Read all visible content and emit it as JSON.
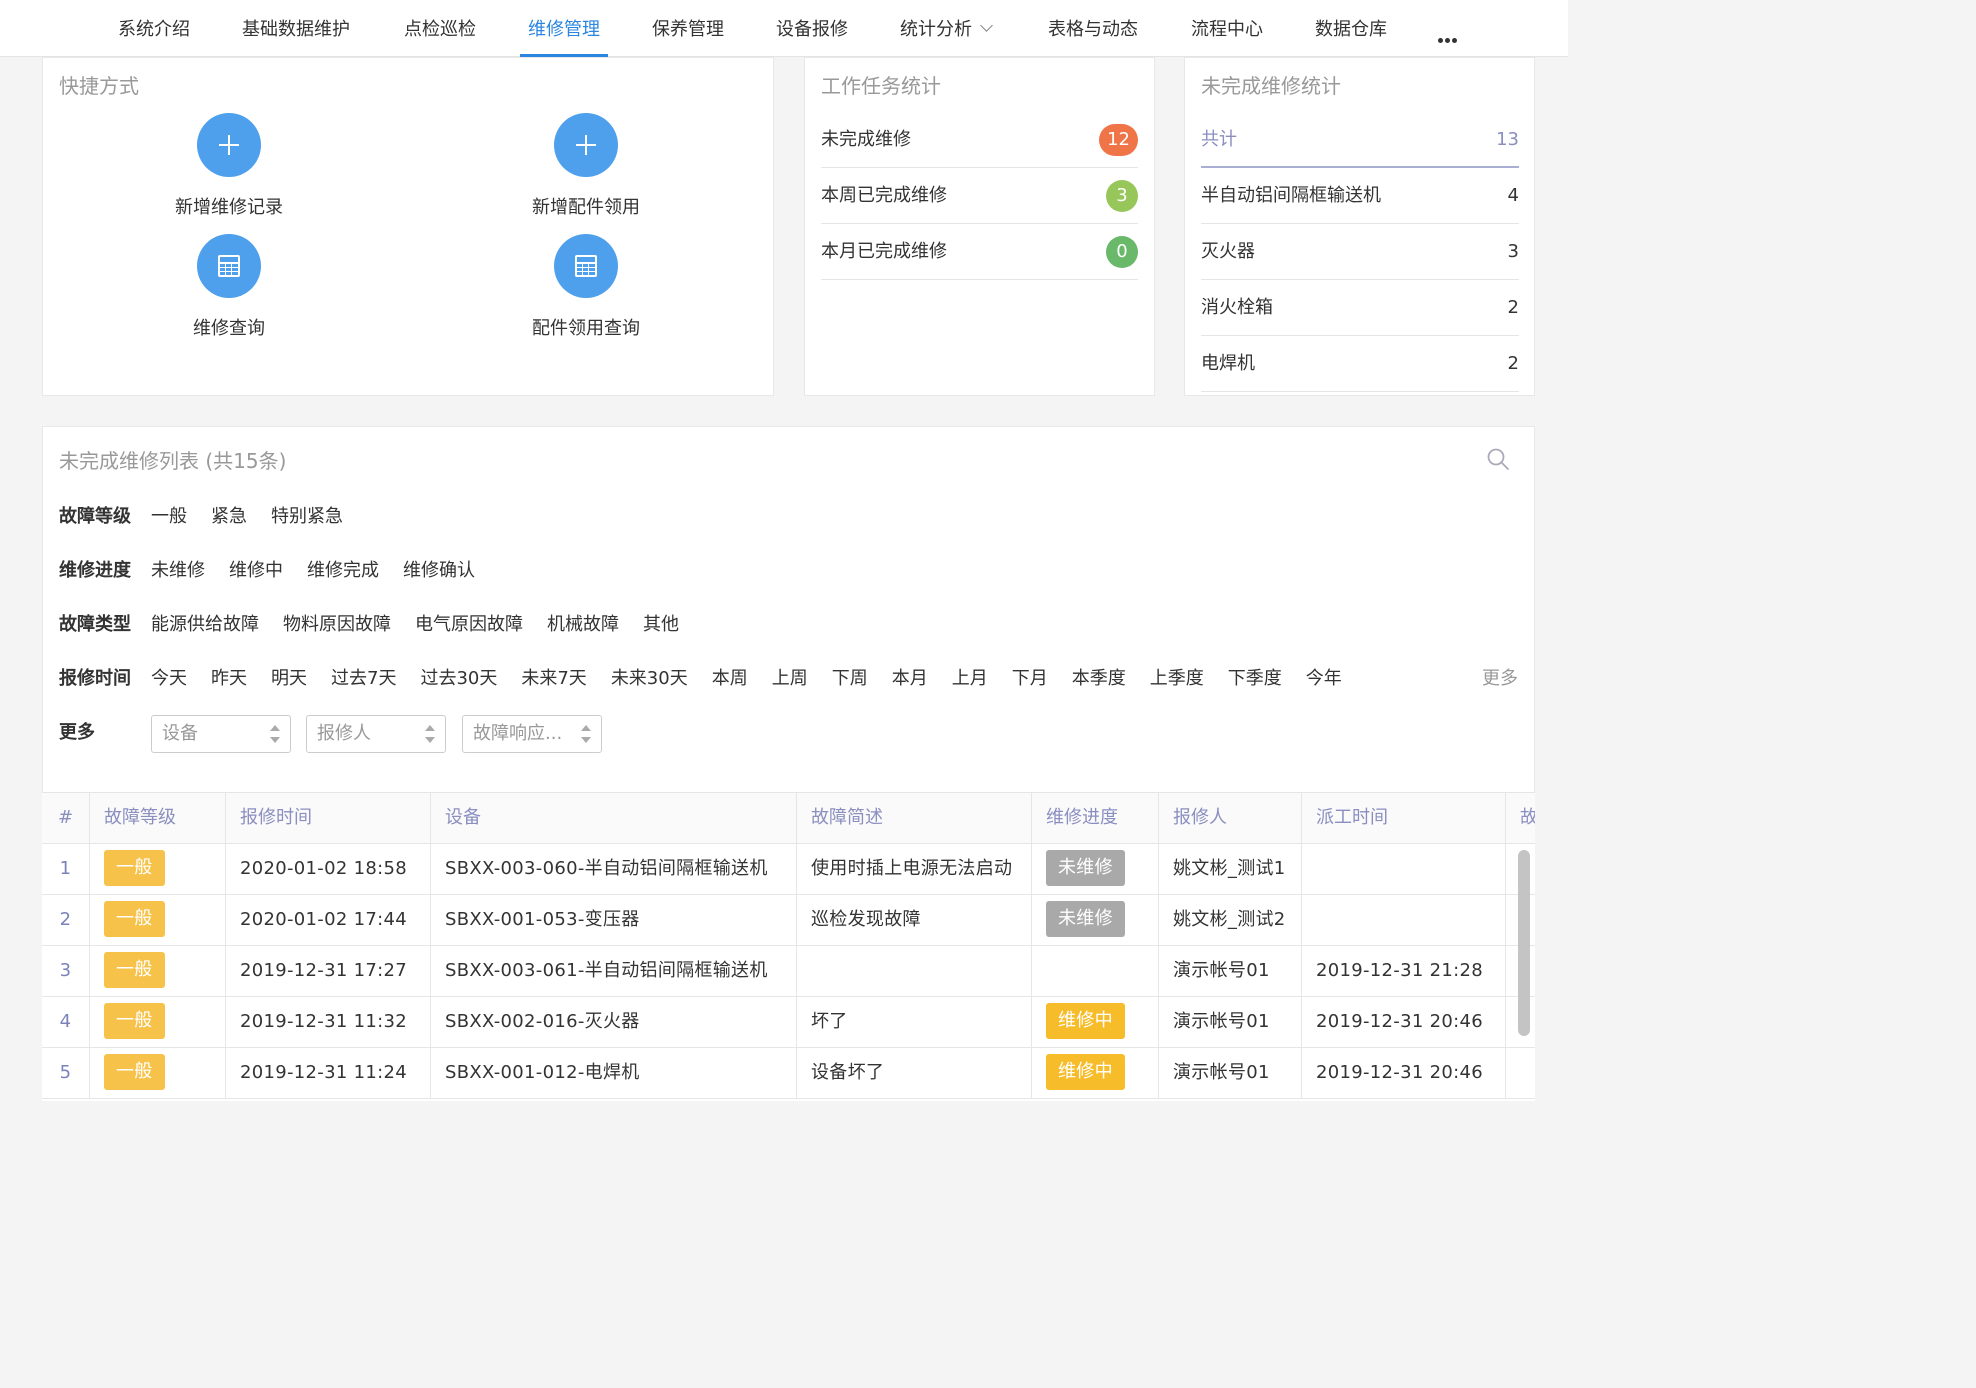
{
  "nav": {
    "items": [
      {
        "label": "系统介绍"
      },
      {
        "label": "基础数据维护"
      },
      {
        "label": "点检巡检"
      },
      {
        "label": "维修管理"
      },
      {
        "label": "保养管理"
      },
      {
        "label": "设备报修"
      },
      {
        "label": "统计分析"
      },
      {
        "label": "表格与动态"
      },
      {
        "label": "流程中心"
      },
      {
        "label": "数据仓库"
      }
    ],
    "active": "维修管理"
  },
  "shortcuts": {
    "title": "快捷方式",
    "items": [
      {
        "label": "新增维修记录",
        "icon": "plus-icon"
      },
      {
        "label": "新增配件领用",
        "icon": "plus-icon"
      },
      {
        "label": "维修查询",
        "icon": "table-icon"
      },
      {
        "label": "配件领用查询",
        "icon": "table-icon"
      }
    ]
  },
  "task_stats": {
    "title": "工作任务统计",
    "rows": [
      {
        "label": "未完成维修",
        "value": "12",
        "color": "#ef7549"
      },
      {
        "label": "本周已完成维修",
        "value": "3",
        "color": "#97c75a"
      },
      {
        "label": "本月已完成维修",
        "value": "0",
        "color": "#6ab86a"
      }
    ]
  },
  "incomplete_stats": {
    "title": "未完成维修统计",
    "total_label": "共计",
    "total_value": "13",
    "rows": [
      {
        "label": "半自动铝间隔框输送机",
        "value": "4"
      },
      {
        "label": "灭火器",
        "value": "3"
      },
      {
        "label": "消火栓箱",
        "value": "2"
      },
      {
        "label": "电焊机",
        "value": "2"
      }
    ]
  },
  "list": {
    "title": "未完成维修列表 (共15条)",
    "filters": {
      "level": {
        "label": "故障等级",
        "options": [
          "一般",
          "紧急",
          "特别紧急"
        ]
      },
      "progress": {
        "label": "维修进度",
        "options": [
          "未维修",
          "维修中",
          "维修完成",
          "维修确认"
        ]
      },
      "type": {
        "label": "故障类型",
        "options": [
          "能源供给故障",
          "物料原因故障",
          "电气原因故障",
          "机械故障",
          "其他"
        ]
      },
      "time": {
        "label": "报修时间",
        "options": [
          "今天",
          "昨天",
          "明天",
          "过去7天",
          "过去30天",
          "未来7天",
          "未来30天",
          "本周",
          "上周",
          "下周",
          "本月",
          "上月",
          "下月",
          "本季度",
          "上季度",
          "下季度",
          "今年"
        ],
        "more": "更多"
      },
      "more": {
        "label": "更多",
        "selects": [
          {
            "placeholder": "设备"
          },
          {
            "placeholder": "报修人"
          },
          {
            "placeholder": "故障响应..."
          }
        ]
      }
    },
    "columns": [
      "#",
      "故障等级",
      "报修时间",
      "设备",
      "故障简述",
      "维修进度",
      "报修人",
      "派工时间",
      "故"
    ],
    "rows": [
      {
        "idx": "1",
        "level": "一般",
        "time": "2020-01-02 18:58",
        "device": "SBXX-003-060-半自动铝间隔框输送机",
        "desc": "使用时插上电源无法启动",
        "progress": "未维修",
        "progress_style": "gray",
        "reporter": "姚文彬_测试1",
        "dispatch": ""
      },
      {
        "idx": "2",
        "level": "一般",
        "time": "2020-01-02 17:44",
        "device": "SBXX-001-053-变压器",
        "desc": "巡检发现故障",
        "progress": "未维修",
        "progress_style": "gray",
        "reporter": "姚文彬_测试2",
        "dispatch": ""
      },
      {
        "idx": "3",
        "level": "一般",
        "time": "2019-12-31 17:27",
        "device": "SBXX-003-061-半自动铝间隔框输送机",
        "desc": "",
        "progress": "",
        "progress_style": "",
        "reporter": "演示帐号01",
        "dispatch": "2019-12-31 21:28"
      },
      {
        "idx": "4",
        "level": "一般",
        "time": "2019-12-31 11:32",
        "device": "SBXX-002-016-灭火器",
        "desc": "坏了",
        "progress": "维修中",
        "progress_style": "yellow",
        "reporter": "演示帐号01",
        "dispatch": "2019-12-31 20:46"
      },
      {
        "idx": "5",
        "level": "一般",
        "time": "2019-12-31 11:24",
        "device": "SBXX-001-012-电焊机",
        "desc": "设备坏了",
        "progress": "维修中",
        "progress_style": "yellow",
        "reporter": "演示帐号01",
        "dispatch": "2019-12-31 20:46"
      }
    ]
  }
}
